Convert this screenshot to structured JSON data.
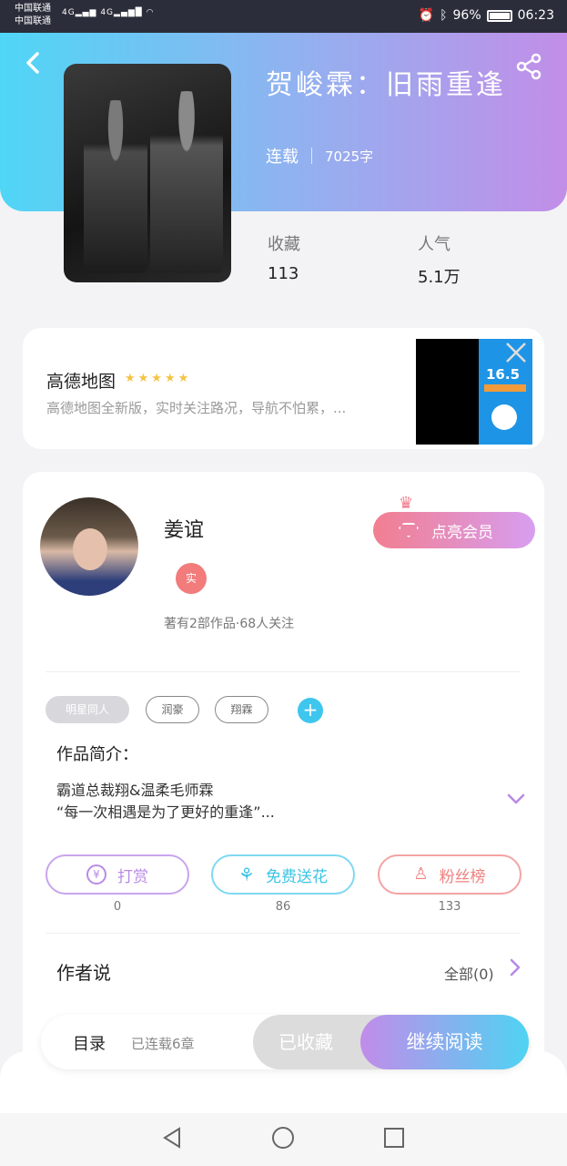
{
  "status_bar": {
    "carrier_1": "中国联通",
    "carrier_2": "中国联通",
    "signal_1": "4G",
    "signal_2": "4G",
    "battery": "96%",
    "time": "06:23"
  },
  "book": {
    "title": "贺峻霖：旧雨重逢",
    "status": "连载",
    "word_count": "7025字",
    "collect_label": "收藏",
    "collect_value": "113",
    "popularity_label": "人气",
    "popularity_value": "5.1万"
  },
  "ad": {
    "title": "高德地图",
    "stars": "★★★★★",
    "rating": 5,
    "description": "高德地图全新版，实时关注路况，导航不怕累，...",
    "image_price": "16.5"
  },
  "author": {
    "name": "姜谊",
    "verified_badge": "实",
    "follow_info": "著有2部作品·68人关注",
    "vip_button": "点亮会员"
  },
  "tags": [
    "明星同人",
    "润豪",
    "翔霖"
  ],
  "intro": {
    "label": "作品简介：",
    "line_1": "霸道总裁翔&温柔毛师霖",
    "line_2": "“每一次相遇是为了更好的重逢”..."
  },
  "actions": [
    {
      "label": "打赏",
      "count": "0",
      "color": "#b98be4"
    },
    {
      "label": "免费送花",
      "count": "86",
      "color": "#3cc4e6"
    },
    {
      "label": "粉丝榜",
      "count": "133",
      "color": "#f08080"
    }
  ],
  "author_says": {
    "label": "作者说",
    "all_link": "全部(0)"
  },
  "bottom_bar": {
    "toc_label": "目录",
    "toc_progress": "已连载6章",
    "collected_button": "已收藏",
    "read_button": "继续阅读"
  },
  "colors": {
    "hero_gradient_start": "#4fd6f6",
    "hero_gradient_end": "#c28ee8",
    "accent_purple": "#b888e6",
    "accent_cyan": "#3fc6ee",
    "accent_red": "#f27b7b"
  }
}
